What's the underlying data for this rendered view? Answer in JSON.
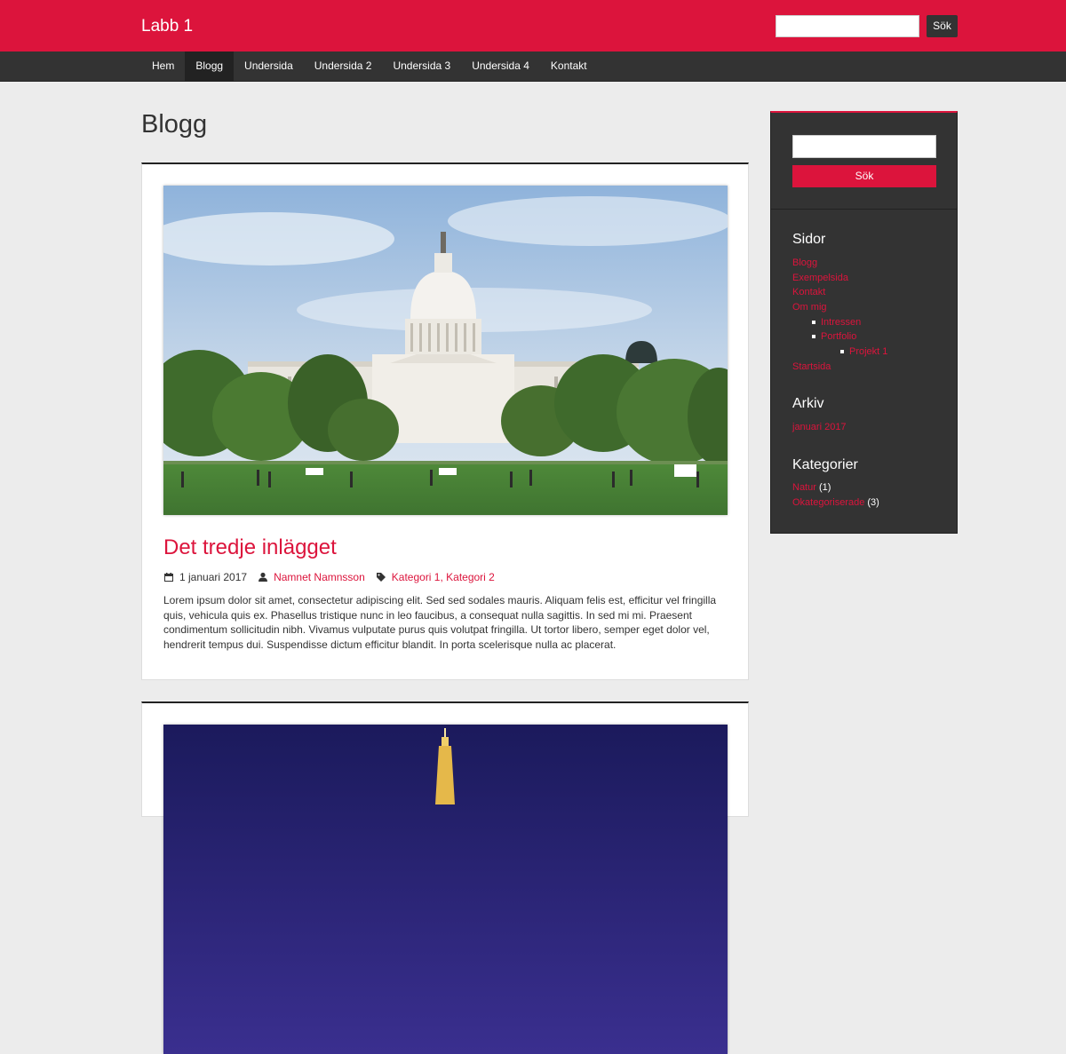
{
  "header": {
    "site_title": "Labb 1",
    "search_button": "Sök",
    "search_value": ""
  },
  "nav": {
    "items": [
      "Hem",
      "Blogg",
      "Undersida",
      "Undersida 2",
      "Undersida 3",
      "Undersida 4",
      "Kontakt"
    ],
    "active": "Blogg"
  },
  "main": {
    "page_title": "Blogg",
    "posts": [
      {
        "title": "Det tredje inlägget",
        "date": "1 januari 2017",
        "author": "Namnet Namnsson",
        "categories": "Kategori 1, Kategori 2",
        "excerpt": "Lorem ipsum dolor sit amet, consectetur adipiscing elit. Sed sed sodales mauris. Aliquam felis est, efficitur vel fringilla quis, vehicula quis ex. Phasellus tristique nunc in leo faucibus, a consequat nulla sagittis. In sed mi mi. Praesent condimentum sollicitudin nibh. Vivamus vulputate purus quis volutpat fringilla. Ut tortor libero, semper eget dolor vel, hendrerit tempus dui. Suspendisse dictum efficitur blandit. In porta scelerisque nulla ac placerat."
      }
    ]
  },
  "sidebar": {
    "search_button": "Sök",
    "pages_title": "Sidor",
    "pages": {
      "blogg": "Blogg",
      "exempelsida": "Exempelsida",
      "kontakt": "Kontakt",
      "om_mig": "Om mig",
      "intressen": "Intressen",
      "portfolio": "Portfolio",
      "projekt1": "Projekt 1",
      "startsida": "Startsida"
    },
    "archive_title": "Arkiv",
    "archive": [
      "januari 2017"
    ],
    "categories_title": "Kategorier",
    "categories": [
      {
        "name": "Natur",
        "count": "(1)"
      },
      {
        "name": "Okategoriserade",
        "count": "(3)"
      }
    ]
  },
  "colors": {
    "accent": "#dc143c",
    "dark": "#333333",
    "background": "#ececec"
  }
}
